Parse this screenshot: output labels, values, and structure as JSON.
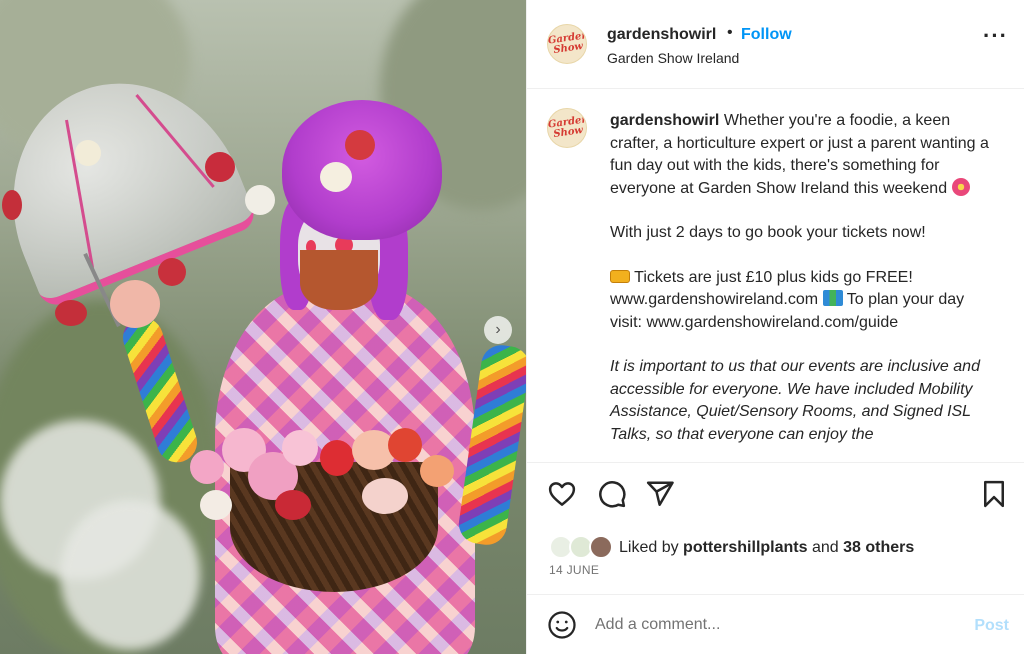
{
  "post": {
    "account": {
      "username": "gardenshowirl",
      "follow_label": "Follow",
      "subtitle": "Garden Show Ireland",
      "avatar_logo": "Garden Show",
      "more_icon": "more-horizontal-icon"
    },
    "caption": {
      "username": "gardenshowirl",
      "paragraphs": [
        "Whether you're a foodie, a keen crafter, a horticulture expert or just a parent wanting a fun day out with the kids, there's something for everyone at Garden Show Ireland this weekend",
        "With just 2 days to go book your tickets now!",
        "Tickets are just £10 plus kids go FREE! www.gardenshowireland.com",
        "To plan your day visit: www.gardenshowireland.com/guide",
        "It is important to us that our events are inclusive and accessible for everyone. We have included Mobility Assistance, Quiet/Sensory Rooms, and Signed ISL Talks, so that everyone can enjoy the"
      ],
      "emojis": [
        "hibiscus-emoji",
        "ticket-emoji",
        "map-emoji"
      ]
    },
    "actions": {
      "icons": [
        "heart-icon",
        "comment-icon",
        "share-icon",
        "bookmark-icon"
      ]
    },
    "likes": {
      "prefix": "Liked by",
      "user": "pottershillplants",
      "and": "and",
      "others": "38 others"
    },
    "date": "14 JUNE",
    "comment": {
      "placeholder": "Add a comment...",
      "post_label": "Post",
      "emoji_icon": "emoji-smile-icon"
    },
    "photo": {
      "next_icon": "chevron-right-icon"
    }
  },
  "colors": {
    "accent": "#0095f6",
    "post_disabled": "#b2dffc",
    "text": "#262626",
    "muted": "#737373"
  }
}
